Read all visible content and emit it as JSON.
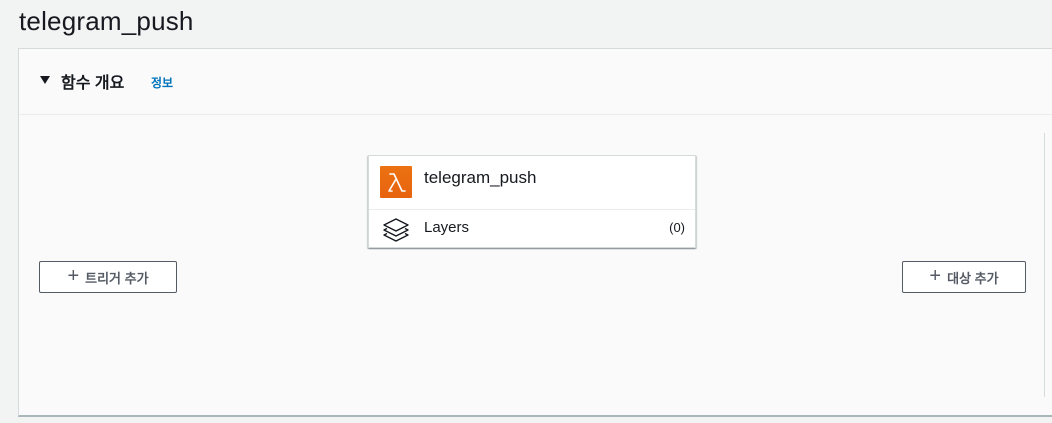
{
  "page": {
    "title": "telegram_push"
  },
  "overview": {
    "heading": "함수 개요",
    "info_link": "정보"
  },
  "function_card": {
    "name": "telegram_push",
    "icon": "lambda-icon",
    "layers_label": "Layers",
    "layers_count": "(0)",
    "layers_icon": "layers-icon"
  },
  "buttons": {
    "add_trigger": "트리거 추가",
    "add_destination": "대상 추가"
  },
  "colors": {
    "lambda_orange": "#ec7211",
    "link_blue": "#0073bb",
    "button_border": "#545b64"
  }
}
